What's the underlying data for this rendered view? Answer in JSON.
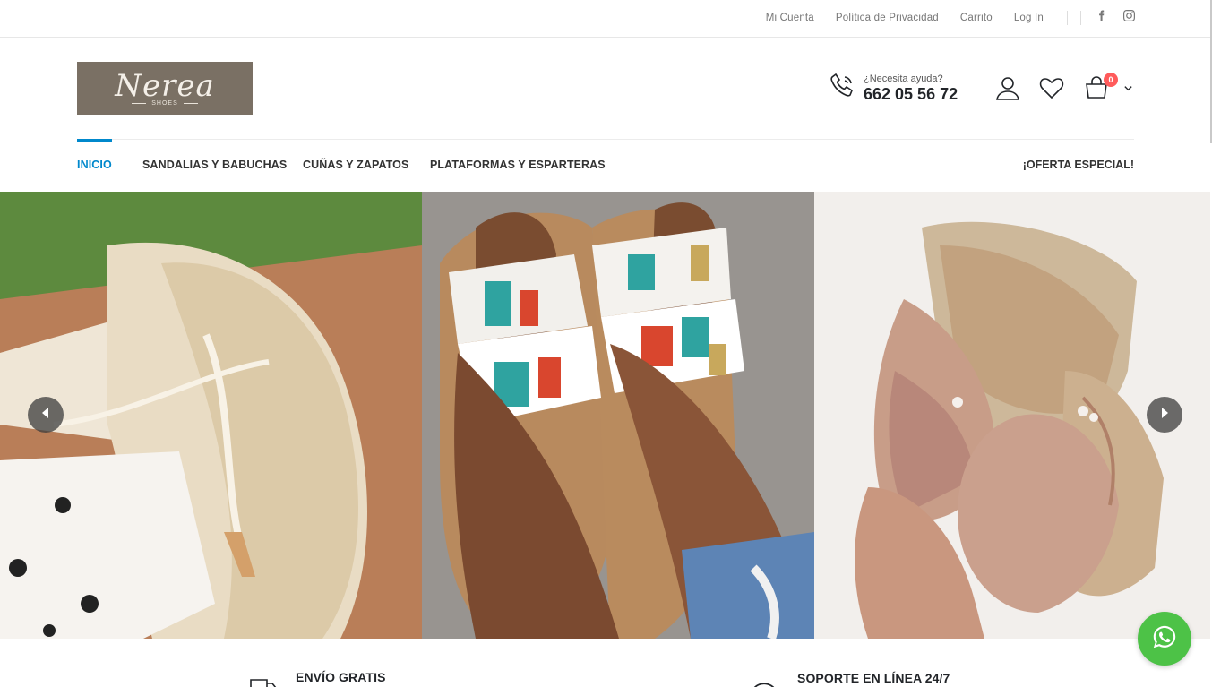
{
  "topbar": {
    "links": [
      "Mi Cuenta",
      "Política de Privacidad",
      "Carrito",
      "Log In"
    ],
    "social": [
      "facebook-icon",
      "instagram-icon"
    ]
  },
  "header": {
    "logo_text": "Nerea",
    "logo_sub": "SHOES",
    "help_label": "¿Necesita ayuda?",
    "phone": "662 05 56 72",
    "cart_count": "0",
    "icons": [
      "phone-icon",
      "user-icon",
      "heart-icon",
      "cart-icon",
      "chevron-down-icon"
    ]
  },
  "nav": {
    "items": [
      "INICIO",
      "SANDALIAS Y BABUCHAS",
      "CUÑAS Y ZAPATOS",
      "PLATAFORMAS Y ESPARTERAS"
    ],
    "offer": "¡OFERTA ESPECIAL!"
  },
  "slider": {
    "prev_icon": "chevron-left-icon",
    "next_icon": "chevron-right-icon"
  },
  "info": {
    "items": [
      {
        "title": "ENVÍO GRATIS",
        "icon": "truck-icon"
      },
      {
        "title": "SOPORTE EN LÍNEA 24/7",
        "icon": "support-24-icon"
      }
    ]
  },
  "colors": {
    "accent": "#0088cc",
    "badge": "#ff5b5b",
    "whatsapp": "#4dc247"
  }
}
